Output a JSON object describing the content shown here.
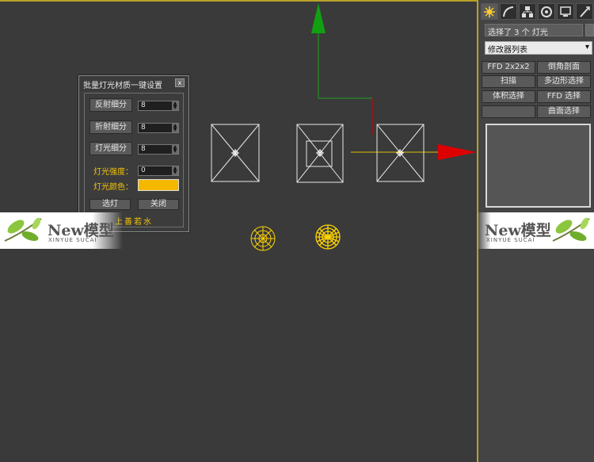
{
  "dialog": {
    "title": "批量灯光材质一键设置",
    "close": "x",
    "reflect_label": "反射细分",
    "reflect_value": "8",
    "refract_label": "折射细分",
    "refract_value": "8",
    "light_sub_label": "灯光细分",
    "light_sub_value": "8",
    "intensity_label": "灯光强度：",
    "intensity_value": "0",
    "color_label": "灯光颜色：",
    "color_value": "#f5b800",
    "select_button": "选灯",
    "close_button": "关闭",
    "footer": "上善若水"
  },
  "panel": {
    "selection_text": "选择了 3 个 灯光",
    "modifier_list": "修改器列表",
    "buttons": [
      "FFD 2x2x2",
      "倒角剖面",
      "扫描",
      "多边形选择",
      "体积选择",
      "FFD 选择",
      "",
      "曲面选择"
    ],
    "tabs": [
      "create-icon",
      "modify-icon",
      "hierarchy-icon",
      "motion-icon",
      "display-icon",
      "utilities-icon"
    ]
  },
  "watermark": {
    "title": "New模型",
    "subtitle": "XINYUE SUCAI"
  },
  "colors": {
    "accent_yellow": "#f3c20a",
    "viewport_bg": "#3a3a3a",
    "gizmo_x": "#e00000",
    "gizmo_y": "#00a000"
  }
}
